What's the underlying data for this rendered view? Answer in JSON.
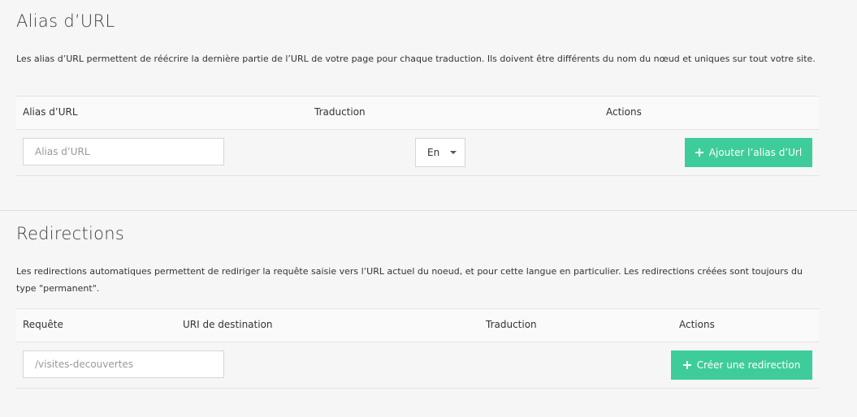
{
  "alias_section": {
    "title": "Alias d’URL",
    "description": "Les alias d’URL permettent de réécrire la dernière partie de l’URL de votre page pour chaque traduction. Ils doivent être différents du nom du nœud et uniques sur tout votre site.",
    "columns": [
      "Alias d’URL",
      "Traduction",
      "Actions"
    ],
    "input": {
      "placeholder": "Alias d’URL",
      "value": ""
    },
    "language_select": {
      "selected": "En"
    },
    "add_button_label": "Ajouter l’alias d’Url"
  },
  "redirect_section": {
    "title": "Redirections",
    "description": "Les redirections automatiques permettent de rediriger la requête saisie vers l’URL actuel du noeud, et pour cette langue en particulier. Les redirections créées sont toujours du type \"permanent\".",
    "columns": [
      "Requête",
      "URI de destination",
      "Traduction",
      "Actions"
    ],
    "input": {
      "placeholder": "/visites-decouvertes",
      "value": ""
    },
    "create_button_label": "Créer une redirection"
  },
  "colors": {
    "accent": "#3ecd9a",
    "background": "#f6f6f6"
  },
  "icons": {
    "button_icon": "plus-icon",
    "select_icon": "caret-down-icon"
  }
}
